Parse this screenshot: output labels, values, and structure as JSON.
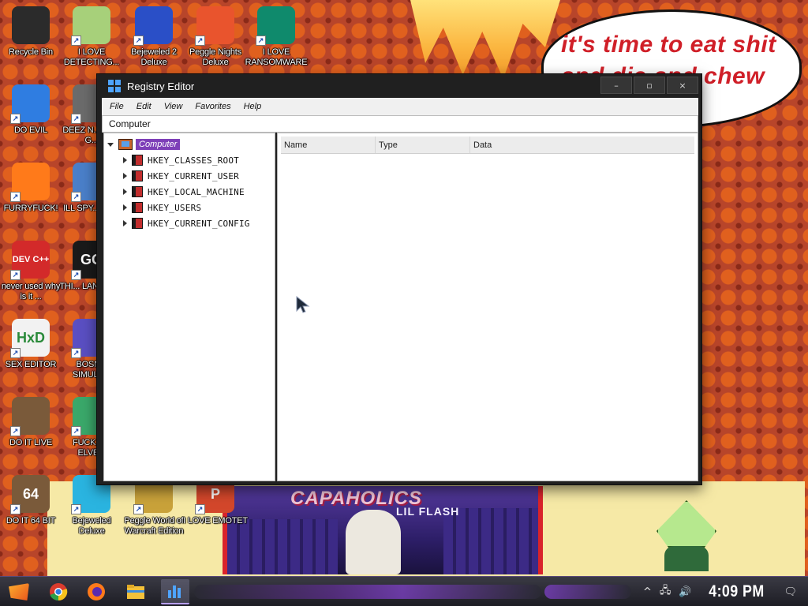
{
  "wallpaper": {
    "speech_bubble": "it's time to eat shit and die and chew",
    "album_title": "CAPAHOLICS",
    "album_subtitle": "LIL FLASH"
  },
  "desktop_icons": [
    {
      "name": "recycle-bin",
      "label": "Recycle Bin",
      "icon": "recycle-bin-icon",
      "color": "#2b2b2b"
    },
    {
      "name": "i-love-detecting",
      "label": "I LOVE DETECTING...",
      "icon": "cartoon-icon",
      "color": "#a7d07a"
    },
    {
      "name": "bejeweled-2-deluxe",
      "label": "Bejeweled 2 Deluxe",
      "icon": "gem-icon",
      "color": "#2a4fc7"
    },
    {
      "name": "peggle-nights-deluxe",
      "label": "Peggle Nights Deluxe",
      "icon": "peggle-icon",
      "color": "#e9542d"
    },
    {
      "name": "i-love-ransomware",
      "label": "I LOVE RANSOMWARE",
      "icon": "publisher-icon",
      "color": "#0f8a6c"
    },
    {
      "name": "do-evil",
      "label": "DO EVIL",
      "icon": "chrome-icon",
      "color": "#2f7de1"
    },
    {
      "name": "deez-nuts",
      "label": "DEEZ N... HAH G...",
      "icon": "document-icon",
      "color": "#6b6b6b"
    },
    {
      "name": "furryfuck",
      "label": "FURRYFUCK!",
      "icon": "firefox-icon",
      "color": "#ff7a1a"
    },
    {
      "name": "ill-spy",
      "label": "ILL SPY... YOU",
      "icon": "spy-icon",
      "color": "#4a7fc9"
    },
    {
      "name": "dev-cpp",
      "label": "never used why is it ...",
      "icon": "devcpp-icon",
      "color": "#d32a2a",
      "glyph": "DEV C++"
    },
    {
      "name": "this-language",
      "label": "THI... LANGUA...",
      "icon": "go-icon",
      "color": "#1a1a1a",
      "glyph": "GO"
    },
    {
      "name": "sex-editor",
      "label": "SEX EDITOR",
      "icon": "hxd-icon",
      "color": "#f2f2f2",
      "glyph": "HxD"
    },
    {
      "name": "bosnia-simulator",
      "label": "BOSN... SIMULA...",
      "icon": "virus-icon",
      "color": "#5a4fc2"
    },
    {
      "name": "do-it-live",
      "label": "DO IT LIVE",
      "icon": "portrait-icon",
      "color": "#7a5a3a"
    },
    {
      "name": "fuck-elves",
      "label": "FUCK S... ELVE...",
      "icon": "anime-icon",
      "color": "#3aa86a"
    },
    {
      "name": "do-it-64-bit",
      "label": "DO IT 64 BIT",
      "icon": "portrait-icon",
      "color": "#7a5a3a",
      "glyph": "64"
    },
    {
      "name": "bejeweled-deluxe",
      "label": "Bejeweled Deluxe",
      "icon": "gem-icon",
      "color": "#2ab4e0"
    },
    {
      "name": "peggle-world-of-warcraft",
      "label": "Peggle World of Warcraft Edition",
      "icon": "peggle-icon",
      "color": "#c9a23a"
    },
    {
      "name": "i-love-emotet",
      "label": "I LOVE EMOTET",
      "icon": "powerpoint-icon",
      "color": "#d3472b",
      "glyph": "P"
    }
  ],
  "window": {
    "title": "Registry Editor",
    "minimize": "–",
    "maximize": "▫",
    "close": "×",
    "menu": [
      "File",
      "Edit",
      "View",
      "Favorites",
      "Help"
    ],
    "address": "Computer",
    "tree_root": "Computer",
    "tree_nodes": [
      "HKEY_CLASSES_ROOT",
      "HKEY_CURRENT_USER",
      "HKEY_LOCAL_MACHINE",
      "HKEY_USERS",
      "HKEY_CURRENT_CONFIG"
    ],
    "columns": [
      "Name",
      "Type",
      "Data"
    ]
  },
  "taskbar": {
    "apps": [
      {
        "name": "start",
        "icon": "start-icon"
      },
      {
        "name": "chrome",
        "icon": "chrome-icon",
        "color": "#2f7de1"
      },
      {
        "name": "firefox",
        "icon": "firefox-icon",
        "color": "#ff7a1a"
      },
      {
        "name": "file-explorer",
        "icon": "folder-icon",
        "color": "#f3c13a"
      },
      {
        "name": "registry-editor",
        "icon": "regedit-icon",
        "color": "#4ea4ff",
        "active": true
      }
    ],
    "tray": {
      "show_hidden": "^",
      "network": "🖧",
      "volume": "🔊",
      "clock": "4:09 PM",
      "notifications": "🗨"
    }
  },
  "colors": {
    "selection": "#7e3fb8",
    "window_frame": "#202020",
    "accent": "#4ea4ff"
  }
}
